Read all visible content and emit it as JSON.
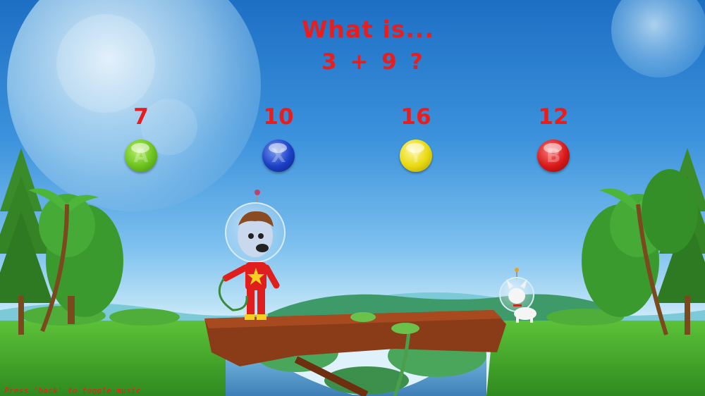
{
  "question": {
    "line1": "What is...",
    "line2": "3 + 9 ?"
  },
  "answers": [
    {
      "value": "7",
      "button": "A",
      "color": "#6cc21e"
    },
    {
      "value": "10",
      "button": "X",
      "color": "#1a3fc4"
    },
    {
      "value": "16",
      "button": "Y",
      "color": "#e8d80e"
    },
    {
      "value": "12",
      "button": "B",
      "color": "#d81818"
    }
  ],
  "footer_hint": "Press 'back' to toggle music",
  "colors": {
    "text_red": "#e81e1e",
    "sky_top": "#1d6fc4",
    "grass": "#3fa02a"
  }
}
